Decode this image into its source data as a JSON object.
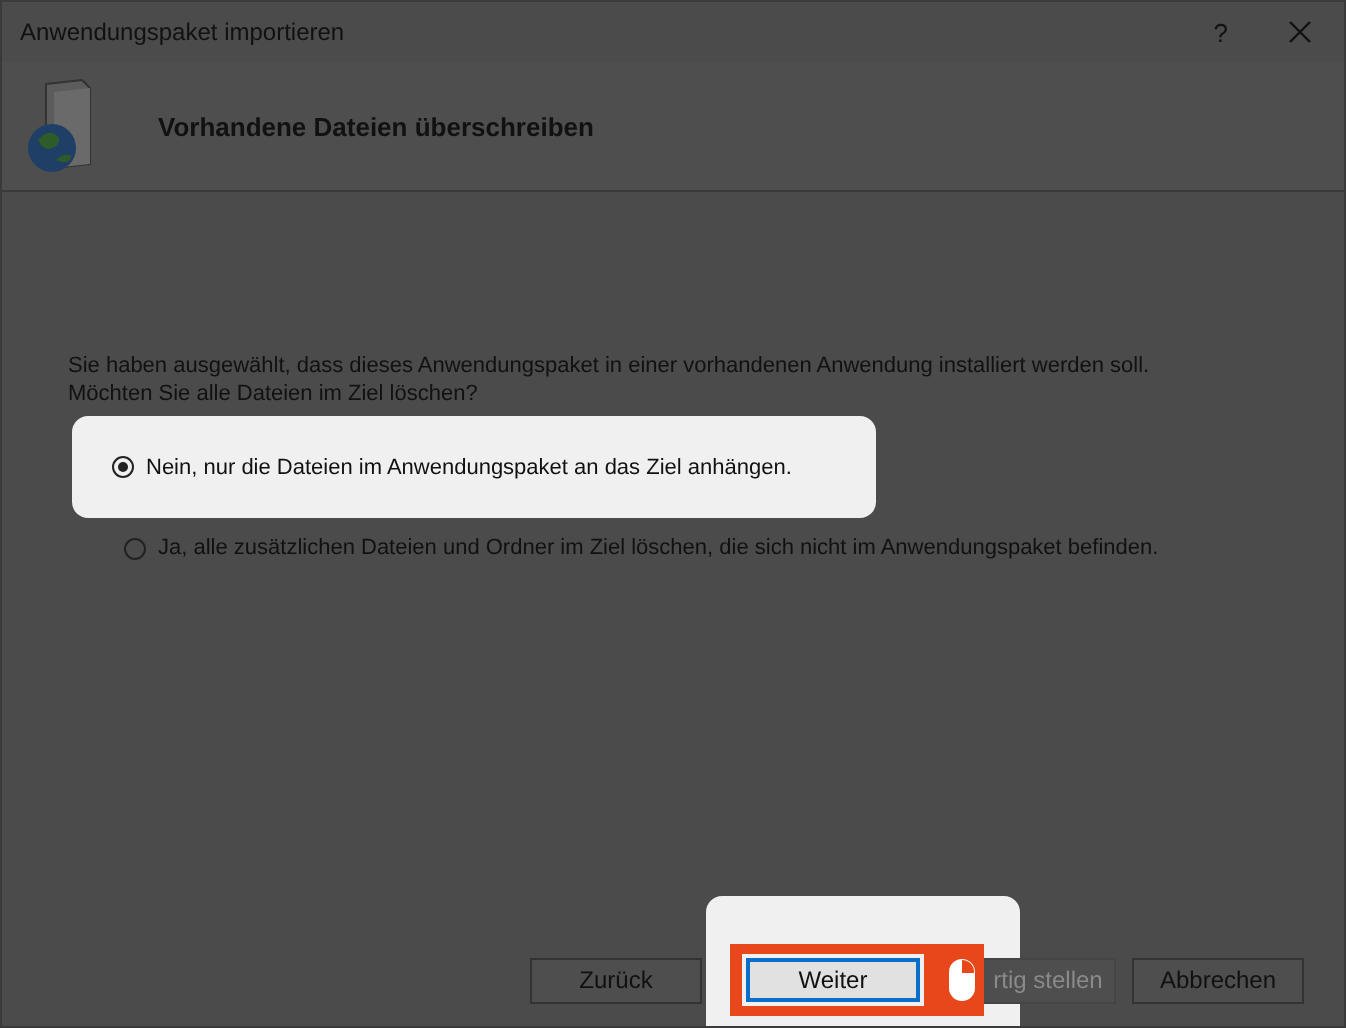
{
  "window": {
    "title": "Anwendungspaket importieren",
    "help": "?"
  },
  "header": {
    "title": "Vorhandene Dateien überschreiben"
  },
  "message": [
    "Sie haben ausgewählt, dass dieses Anwendungspaket in einer vorhandenen Anwendung installiert werden soll.",
    "Möchten Sie alle Dateien im Ziel löschen?"
  ],
  "options": [
    {
      "label": "Nein, nur die Dateien im Anwendungspaket an das Ziel anhängen.",
      "selected": true,
      "highlighted": true
    },
    {
      "label": "Ja, alle zusätzlichen Dateien und Ordner im Ziel löschen, die sich nicht im Anwendungspaket befinden.",
      "selected": false,
      "highlighted": false
    }
  ],
  "buttons": [
    {
      "label": "Zurück",
      "disabled": false,
      "highlighted": false
    },
    {
      "label": "Weiter",
      "disabled": false,
      "highlighted": true
    },
    {
      "label": "rtig stellen",
      "disabled": true,
      "highlighted": false
    },
    {
      "label": "Abbrechen",
      "disabled": false,
      "highlighted": false
    }
  ]
}
